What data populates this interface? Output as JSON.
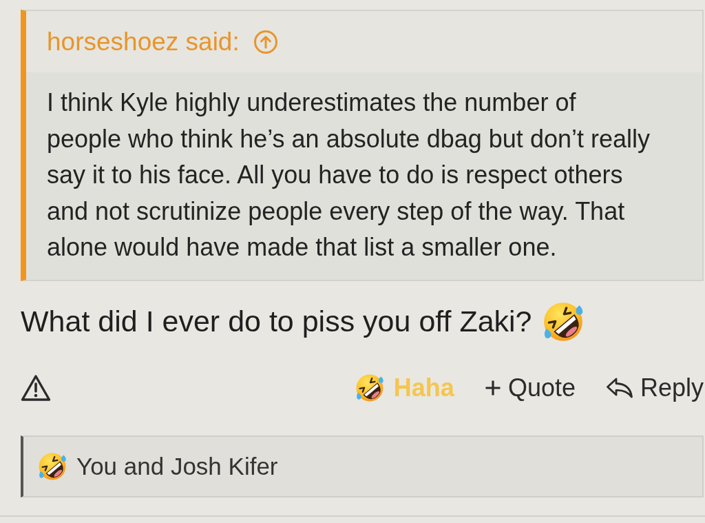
{
  "quote": {
    "author": "horseshoez said:",
    "text": "I think Kyle highly underestimates the number of people who think he’s an absolute dbag but don’t really say it to his face. All you have to do is respect others and not scrutinize people every step of the way. That alone would have made that list a smaller one."
  },
  "message": {
    "text": "What did I ever do to piss you off Zaki?"
  },
  "actions": [
    {
      "kind": "reaction",
      "label": "Haha",
      "selected": true
    },
    {
      "kind": "quote",
      "label": "Quote"
    },
    {
      "kind": "reply",
      "label": "Reply"
    }
  ],
  "reactions_summary": {
    "text": "You and Josh Kifer"
  }
}
